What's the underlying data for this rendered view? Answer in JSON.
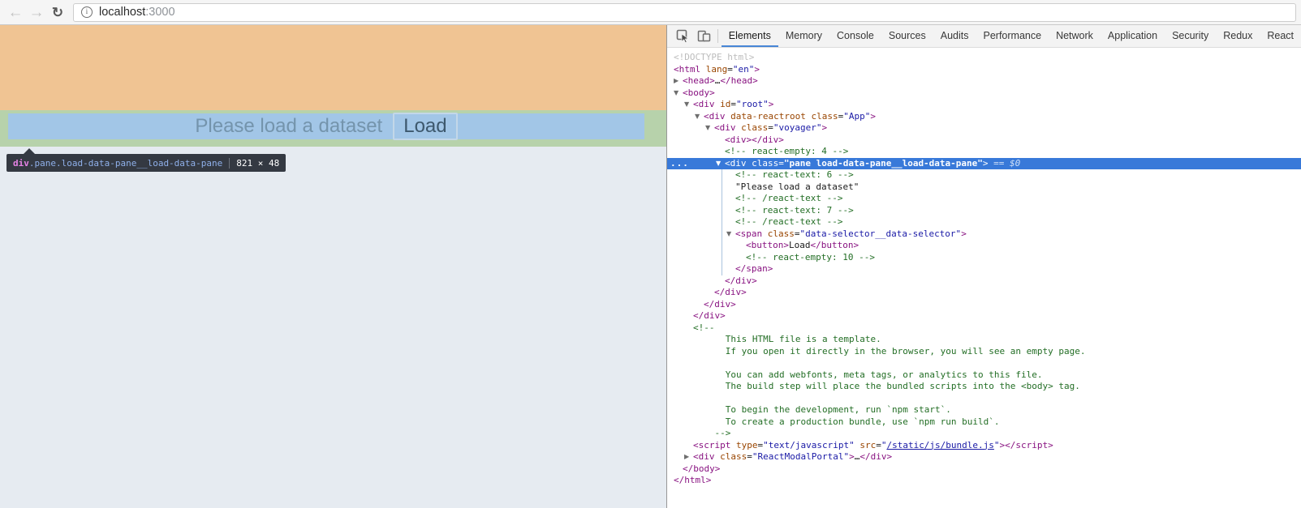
{
  "browser": {
    "back_icon": "←",
    "forward_icon": "→",
    "reload_icon": "↻",
    "url_host": "localhost",
    "url_port": ":3000"
  },
  "page": {
    "message": "Please load a dataset",
    "load_button_label": "Load",
    "tooltip": {
      "tag": "div",
      "classes": ".pane.load-data-pane__load-data-pane",
      "dims": "821 × 48"
    },
    "colors": {
      "margin_overlay": "#f0c493",
      "padding_overlay": "#b7d2ab",
      "content_overlay": "#a2c6e7",
      "page_bg": "#e6ebf1",
      "tooltip_bg": "#343942"
    }
  },
  "devtools": {
    "icons": {
      "arrow_down": "▼",
      "arrow_right": "▶",
      "overflow_dots": "...",
      "inspect": "inspect-element-icon",
      "device": "device-toolbar-icon"
    },
    "tabs": [
      {
        "label": "Elements",
        "selected": true
      },
      {
        "label": "Memory",
        "selected": false
      },
      {
        "label": "Console",
        "selected": false
      },
      {
        "label": "Sources",
        "selected": false
      },
      {
        "label": "Audits",
        "selected": false
      },
      {
        "label": "Performance",
        "selected": false
      },
      {
        "label": "Network",
        "selected": false
      },
      {
        "label": "Application",
        "selected": false
      },
      {
        "label": "Security",
        "selected": false
      },
      {
        "label": "Redux",
        "selected": false
      },
      {
        "label": "React",
        "selected": false
      }
    ],
    "colors": {
      "selected_row_bg": "#3879d9",
      "tag": "#881280",
      "attr": "#994500",
      "value": "#1a1aa6",
      "comment": "#236e25",
      "doctype": "#bcbcbc",
      "tab_underline": "#4786d6"
    },
    "code_lines": [
      {
        "u": 0,
        "toks": [
          [
            "dim",
            "<!DOCTYPE html>"
          ]
        ]
      },
      {
        "u": 0,
        "toks": [
          [
            "tag",
            "<html"
          ],
          [
            "txt",
            " "
          ],
          [
            "attr",
            "lang"
          ],
          [
            "txt",
            "="
          ],
          [
            "val",
            "\"en\""
          ],
          [
            "tag",
            ">"
          ]
        ]
      },
      {
        "u": 0,
        "pre": "ar",
        "toks": [
          [
            "tag",
            "<head>"
          ],
          [
            "ell",
            "…"
          ],
          [
            "tag",
            "</head>"
          ]
        ]
      },
      {
        "u": 0,
        "pre": "ad",
        "toks": [
          [
            "tag",
            "<body>"
          ]
        ]
      },
      {
        "u": 1,
        "pre": "ad",
        "toks": [
          [
            "tag",
            "<div"
          ],
          [
            "txt",
            " "
          ],
          [
            "attr",
            "id"
          ],
          [
            "txt",
            "="
          ],
          [
            "val",
            "\"root\""
          ],
          [
            "tag",
            ">"
          ]
        ]
      },
      {
        "u": 2,
        "pre": "ad",
        "toks": [
          [
            "tag",
            "<div"
          ],
          [
            "txt",
            " "
          ],
          [
            "attr",
            "data-reactroot"
          ],
          [
            "txt",
            " "
          ],
          [
            "attr",
            "class"
          ],
          [
            "txt",
            "="
          ],
          [
            "val",
            "\"App\""
          ],
          [
            "tag",
            ">"
          ]
        ]
      },
      {
        "u": 3,
        "pre": "ad",
        "toks": [
          [
            "tag",
            "<div"
          ],
          [
            "txt",
            " "
          ],
          [
            "attr",
            "class"
          ],
          [
            "txt",
            "="
          ],
          [
            "val",
            "\"voyager\""
          ],
          [
            "tag",
            ">"
          ]
        ]
      },
      {
        "u": 4,
        "pre": "sp",
        "toks": [
          [
            "tag",
            "<div></div>"
          ]
        ]
      },
      {
        "u": 4,
        "pre": "sp",
        "toks": [
          [
            "com",
            "<!-- react-empty: 4 -->"
          ]
        ]
      },
      {
        "u": 4,
        "pre": "ad",
        "sel": true,
        "toks": [
          [
            "tag",
            "<div"
          ],
          [
            "txt",
            " "
          ],
          [
            "attr",
            "class"
          ],
          [
            "txt",
            "="
          ],
          [
            "val",
            "\"pane load-data-pane__load-data-pane\""
          ],
          [
            "tag",
            ">"
          ],
          [
            "meta",
            " == $0"
          ]
        ]
      },
      {
        "u": 5,
        "pre": "sp",
        "toks": [
          [
            "com",
            "<!-- react-text: 6 -->"
          ]
        ]
      },
      {
        "u": 5,
        "pre": "sp",
        "toks": [
          [
            "txt",
            "\"Please load a dataset\""
          ]
        ]
      },
      {
        "u": 5,
        "pre": "sp",
        "toks": [
          [
            "com",
            "<!-- /react-text -->"
          ]
        ]
      },
      {
        "u": 5,
        "pre": "sp",
        "toks": [
          [
            "com",
            "<!-- react-text: 7 -->"
          ]
        ]
      },
      {
        "u": 5,
        "pre": "sp",
        "toks": [
          [
            "com",
            "<!-- /react-text -->"
          ]
        ]
      },
      {
        "u": 5,
        "pre": "ad",
        "toks": [
          [
            "tag",
            "<span"
          ],
          [
            "txt",
            " "
          ],
          [
            "attr",
            "class"
          ],
          [
            "txt",
            "="
          ],
          [
            "val",
            "\"data-selector__data-selector\""
          ],
          [
            "tag",
            ">"
          ]
        ]
      },
      {
        "u": 6,
        "pre": "sp",
        "toks": [
          [
            "tag",
            "<button>"
          ],
          [
            "txt",
            "Load"
          ],
          [
            "tag",
            "</button>"
          ]
        ]
      },
      {
        "u": 6,
        "pre": "sp",
        "toks": [
          [
            "com",
            "<!-- react-empty: 10 -->"
          ]
        ]
      },
      {
        "u": 5,
        "pre": "sp",
        "toks": [
          [
            "tag",
            "</span>"
          ]
        ]
      },
      {
        "u": 4,
        "pre": "sp",
        "toks": [
          [
            "tag",
            "</div>"
          ]
        ]
      },
      {
        "u": 3,
        "pre": "sp",
        "toks": [
          [
            "tag",
            "</div>"
          ]
        ]
      },
      {
        "u": 2,
        "pre": "sp",
        "toks": [
          [
            "tag",
            "</div>"
          ]
        ]
      },
      {
        "u": 1,
        "pre": "sp",
        "toks": [
          [
            "tag",
            "</div>"
          ]
        ]
      },
      {
        "u": 1,
        "pre": "sp",
        "toks": [
          [
            "com",
            "<!--"
          ]
        ]
      },
      {
        "u": 1,
        "pre": "sp",
        "toks": [
          [
            "com",
            "      This HTML file is a template."
          ]
        ]
      },
      {
        "u": 1,
        "pre": "sp",
        "toks": [
          [
            "com",
            "      If you open it directly in the browser, you will see an empty page."
          ]
        ]
      },
      {
        "u": 0,
        "toks": []
      },
      {
        "u": 1,
        "pre": "sp",
        "toks": [
          [
            "com",
            "      You can add webfonts, meta tags, or analytics to this file."
          ]
        ]
      },
      {
        "u": 1,
        "pre": "sp",
        "toks": [
          [
            "com",
            "      The build step will place the bundled scripts into the <body> tag."
          ]
        ]
      },
      {
        "u": 0,
        "toks": []
      },
      {
        "u": 1,
        "pre": "sp",
        "toks": [
          [
            "com",
            "      To begin the development, run `npm start`."
          ]
        ]
      },
      {
        "u": 1,
        "pre": "sp",
        "toks": [
          [
            "com",
            "      To create a production bundle, use `npm run build`."
          ]
        ]
      },
      {
        "u": 1,
        "pre": "sp",
        "toks": [
          [
            "com",
            "    -->"
          ]
        ]
      },
      {
        "u": 1,
        "pre": "sp",
        "toks": [
          [
            "tag",
            "<script"
          ],
          [
            "txt",
            " "
          ],
          [
            "attr",
            "type"
          ],
          [
            "txt",
            "="
          ],
          [
            "val",
            "\"text/javascript\""
          ],
          [
            "txt",
            " "
          ],
          [
            "attr",
            "src"
          ],
          [
            "txt",
            "="
          ],
          [
            "val",
            "\""
          ],
          [
            "link",
            "/static/js/bundle.js"
          ],
          [
            "val",
            "\""
          ],
          [
            "tag",
            "></script>"
          ]
        ]
      },
      {
        "u": 1,
        "pre": "ar",
        "toks": [
          [
            "tag",
            "<div"
          ],
          [
            "txt",
            " "
          ],
          [
            "attr",
            "class"
          ],
          [
            "txt",
            "="
          ],
          [
            "val",
            "\"ReactModalPortal\""
          ],
          [
            "tag",
            ">"
          ],
          [
            "ell",
            "…"
          ],
          [
            "tag",
            "</div>"
          ]
        ]
      },
      {
        "u": 0,
        "pre": "sp",
        "toks": [
          [
            "tag",
            "</body>"
          ]
        ]
      },
      {
        "u": 0,
        "toks": [
          [
            "tag",
            "</html>"
          ]
        ]
      }
    ]
  }
}
